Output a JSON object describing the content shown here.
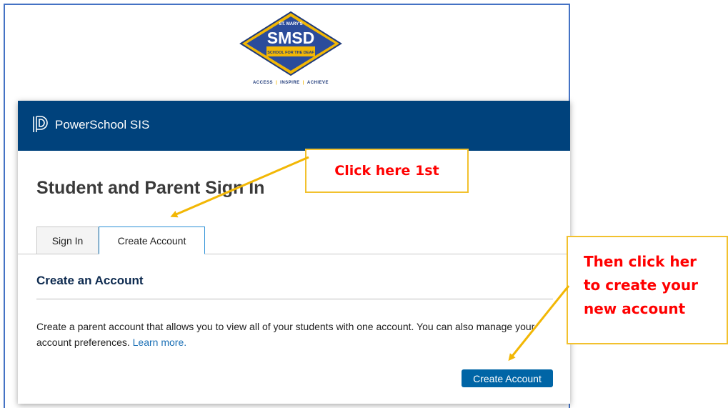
{
  "logo": {
    "top_text": "ST. MARY'S",
    "main_text": "SMSD",
    "bottom_text": "SCHOOL FOR THE DEAF",
    "tagline": [
      "ACCESS",
      "INSPIRE",
      "ACHIEVE"
    ]
  },
  "header": {
    "app_title": "PowerSchool SIS"
  },
  "page": {
    "title": "Student and Parent Sign In"
  },
  "tabs": [
    {
      "label": "Sign In",
      "active": false
    },
    {
      "label": "Create Account",
      "active": true
    }
  ],
  "section": {
    "title": "Create an Account",
    "description": "Create a parent account that allows you to view all of your students with one account. You can also manage your account preferences.",
    "learn_more": "Learn more."
  },
  "create_button": {
    "label": "Create Account"
  },
  "annotations": {
    "first": "Click here 1st",
    "second_lines": [
      "Then click her",
      "to create your",
      "new account"
    ]
  },
  "colors": {
    "header_bg": "#00427c",
    "button_bg": "#0065a6",
    "callout_border": "#f2c12e",
    "callout_text": "#ff0000",
    "frame_border": "#4472c4"
  }
}
